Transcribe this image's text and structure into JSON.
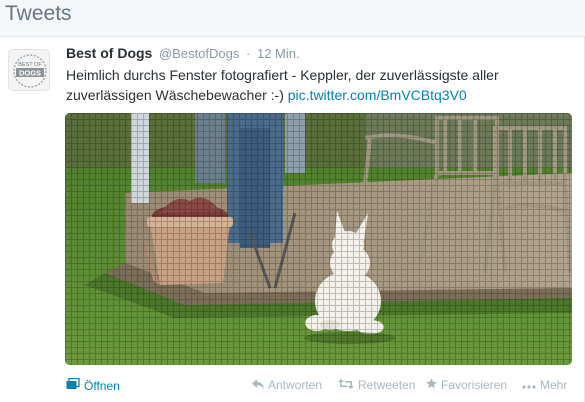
{
  "header": {
    "title": "Tweets"
  },
  "tweet": {
    "avatar_logo": "BEST OF DOGS",
    "name": "Best of Dogs",
    "handle": "@BestofDogs",
    "separator": "·",
    "time": "12 Min.",
    "text": "Heimlich durchs Fenster fotografiert - Keppler, der zuverlässigste aller zuverlässigen Wäschebewacher :-)",
    "link": "pic.twitter.com/BmVCBtq3V0"
  },
  "actions": {
    "open": "Öffnen",
    "reply": "Antworten",
    "retweet": "Retweeten",
    "favorite": "Favorisieren",
    "more": "Mehr"
  },
  "colors": {
    "link": "#0084b4",
    "muted": "#8899a6",
    "action_inactive": "#aab8c2"
  },
  "icons": {
    "open": "expand-icon",
    "reply": "reply-arrow-icon",
    "retweet": "retweet-icon",
    "favorite": "star-icon",
    "more": "ellipsis-icon"
  }
}
